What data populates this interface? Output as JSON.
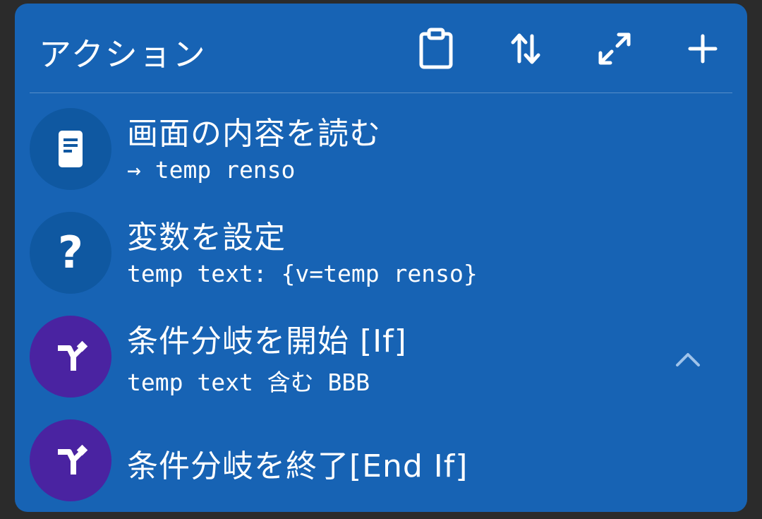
{
  "header": {
    "title": "アクション",
    "buttons": [
      {
        "name": "clipboard-icon"
      },
      {
        "name": "sort-icon"
      },
      {
        "name": "expand-icon"
      },
      {
        "name": "add-icon"
      }
    ]
  },
  "actions": [
    {
      "title": "画面の内容を読む",
      "subtitle": "→ temp renso",
      "icon": "document-icon",
      "icon_color": "#0f58a1"
    },
    {
      "title": "変数を設定",
      "subtitle": "temp text: {v=temp renso}",
      "icon": "question-icon",
      "icon_glyph": "?",
      "icon_color": "#0f58a1"
    },
    {
      "title": "条件分岐を開始 [If]",
      "subtitle": "temp text 含む BBB",
      "icon": "branch-icon",
      "icon_color": "#4a23a1",
      "collapse_icon": "chevron-up-icon"
    },
    {
      "title": "条件分岐を終了[End If]",
      "subtitle": "",
      "icon": "branch-icon",
      "icon_color": "#4a23a1"
    }
  ],
  "colors": {
    "background": "#2b2b2b",
    "card": "#1763b4",
    "icon_blue": "#0f58a1",
    "icon_purple": "#4a23a1"
  }
}
